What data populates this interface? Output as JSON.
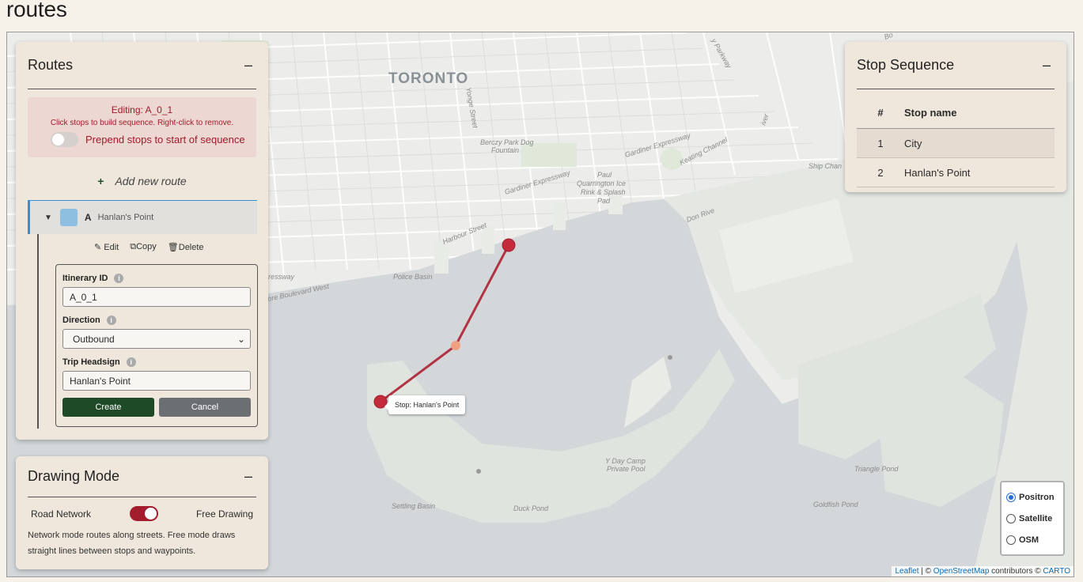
{
  "page": {
    "title": "routes"
  },
  "map_labels": {
    "toronto": "TORONTO",
    "yonge": "Yonge Street",
    "berczy": "Berczy Park Dog",
    "berczy2": "Fountain",
    "gardiner1": "Gardiner Expressway",
    "gardiner2": "Gardiner Expressway",
    "keating": "Keating Channel",
    "paul1": "Paul",
    "paul2": "Quarrington Ice",
    "paul3": "Rink & Splash",
    "paul4": "Pad",
    "harbour": "Harbour Street",
    "police": "Police Basin",
    "lakeshore": "ore Boulevard West",
    "xpressway": "ressway",
    "don": "Don Rive",
    "ship": "Ship Chan",
    "yday1": "Y Day Camp",
    "yday2": "Private Pool",
    "settling": "Settling Basin",
    "duck": "Duck Pond",
    "triangle": "Triangle Pond",
    "goldfish": "Goldfish Pond",
    "parkway": "y Parkway",
    "river": "iver",
    "bo": "Bo"
  },
  "routes_panel": {
    "title": "Routes",
    "collapse": "–",
    "editing": "Editing: A_0_1",
    "hint": "Click stops to build sequence. Right-click to remove.",
    "prepend_label": "Prepend stops to start of sequence",
    "add_plus": "+",
    "add_label": "Add new route",
    "route": {
      "caret": "▼",
      "letter": "A",
      "name": "Hanlan's Point",
      "color": "#8fbfe0"
    },
    "actions": {
      "edit": "✎ Edit",
      "copy": "Copy",
      "delete": "Delete"
    },
    "form": {
      "itinerary_label": "Itinerary ID",
      "itinerary_value": "A_0_1",
      "direction_label": "Direction",
      "direction_value": "Outbound",
      "headsign_label": "Trip Headsign",
      "headsign_value": "Hanlan's Point",
      "info": "i",
      "create": "Create",
      "cancel": "Cancel"
    }
  },
  "drawing_panel": {
    "title": "Drawing Mode",
    "collapse": "–",
    "left_label": "Road Network",
    "right_label": "Free Drawing",
    "description": "Network mode routes along streets. Free mode draws straight lines between stops and waypoints."
  },
  "stops_panel": {
    "title": "Stop Sequence",
    "collapse": "–",
    "col_num": "#",
    "col_name": "Stop name",
    "rows": [
      {
        "num": "1",
        "name": "City"
      },
      {
        "num": "2",
        "name": "Hanlan's Point"
      }
    ]
  },
  "tooltip": "Stop: Hanlan's Point",
  "layers": {
    "positron": "Positron",
    "satellite": "Satellite",
    "osm": "OSM",
    "selected": "Positron"
  },
  "attribution": {
    "leaflet": "Leaflet",
    "sep1": " | © ",
    "osm": "OpenStreetMap",
    "mid": " contributors © ",
    "carto": "CARTO"
  },
  "colors": {
    "route_line": "#b23443",
    "stop": "#c42a3a",
    "waypoint": "#f0a080",
    "water": "#d3d7d9",
    "land": "#e9ebe6"
  }
}
